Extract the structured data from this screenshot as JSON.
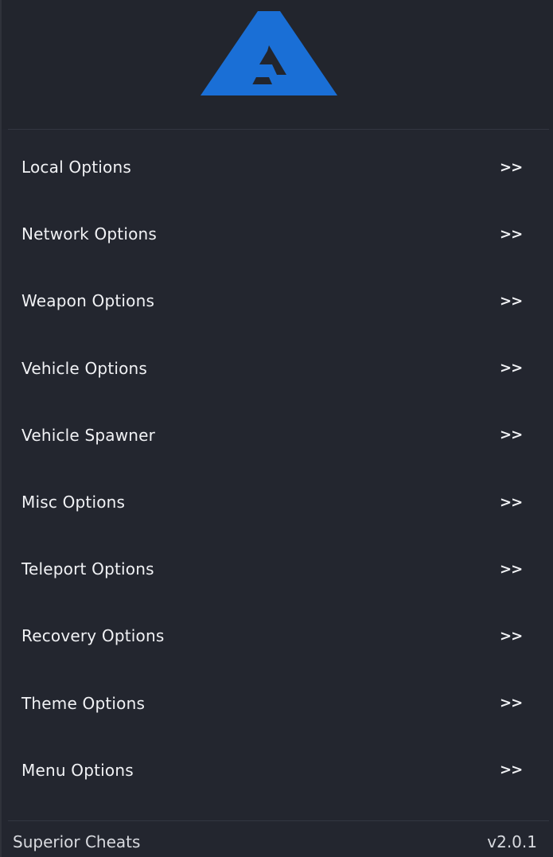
{
  "menu": {
    "items": [
      {
        "label": "Local Options",
        "arrow": ">>"
      },
      {
        "label": "Network Options",
        "arrow": ">>"
      },
      {
        "label": "Weapon Options",
        "arrow": ">>"
      },
      {
        "label": "Vehicle Options",
        "arrow": ">>"
      },
      {
        "label": "Vehicle Spawner",
        "arrow": ">>"
      },
      {
        "label": "Misc Options",
        "arrow": ">>"
      },
      {
        "label": "Teleport Options",
        "arrow": ">>"
      },
      {
        "label": "Recovery Options",
        "arrow": ">>"
      },
      {
        "label": "Theme Options",
        "arrow": ">>"
      },
      {
        "label": "Menu Options",
        "arrow": ">>"
      }
    ]
  },
  "footer": {
    "brand": "Superior Cheats",
    "version": "v2.0.1"
  },
  "colors": {
    "accent": "#1a6fd6",
    "panel": "#23262f",
    "text": "#f1f2f5"
  },
  "header": {
    "logo_icon": "brand-logo-icon"
  }
}
